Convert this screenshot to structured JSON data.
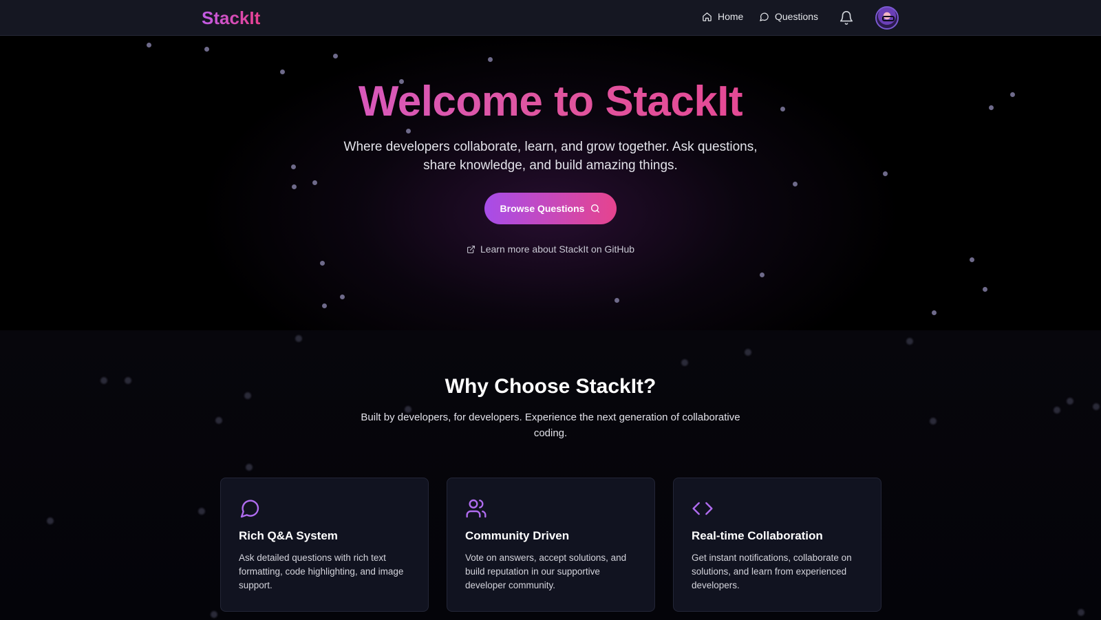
{
  "nav": {
    "logo": "StackIt",
    "home": "Home",
    "questions": "Questions"
  },
  "hero": {
    "title": "Welcome to StackIt",
    "subtitle": "Where developers collaborate, learn, and grow together. Ask questions, share knowledge, and build amazing things.",
    "browse_button": "Browse Questions",
    "github_link": "Learn more about StackIt on GitHub"
  },
  "why": {
    "title": "Why Choose StackIt?",
    "subtitle": "Built by developers, for developers. Experience the next generation of collaborative coding."
  },
  "features": [
    {
      "icon": "message-circle-icon",
      "title": "Rich Q&A System",
      "description": "Ask detailed questions with rich text formatting, code highlighting, and image support."
    },
    {
      "icon": "users-icon",
      "title": "Community Driven",
      "description": "Vote on answers, accept solutions, and build reputation in our supportive developer community."
    },
    {
      "icon": "code-icon",
      "title": "Real-time Collaboration",
      "description": "Get instant notifications, collaborate on solutions, and learn from experienced developers."
    }
  ],
  "colors": {
    "background": "#000000",
    "navbar": "#151722",
    "accent_purple": "#a74de9",
    "accent_pink": "#e6448e",
    "card": "#111320",
    "icon_purple": "#b06cf0"
  }
}
